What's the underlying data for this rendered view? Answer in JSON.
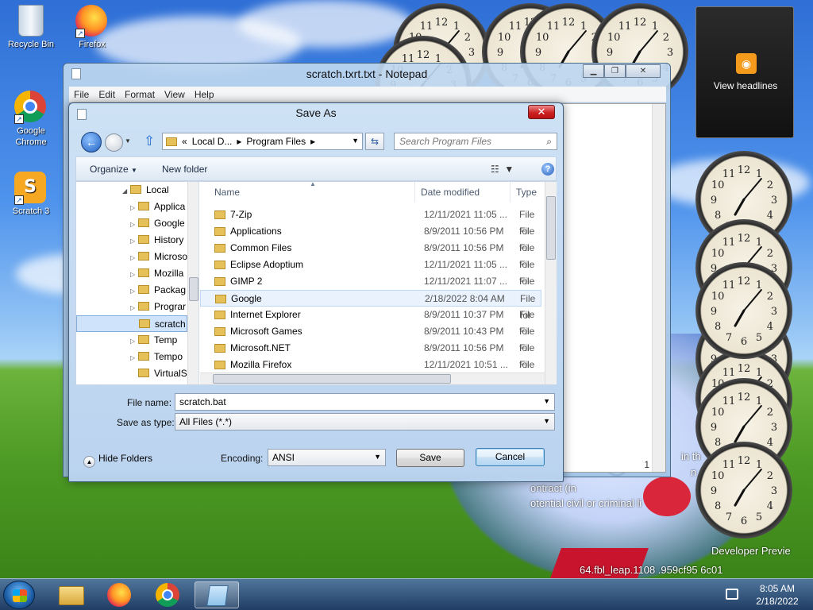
{
  "desktop": {
    "icons": [
      {
        "label": "Recycle Bin",
        "icon": "recycle-bin-icon"
      },
      {
        "label": "Firefox",
        "icon": "firefox-icon"
      },
      {
        "label": "Google Chrome",
        "icon": "chrome-icon"
      },
      {
        "label": "Scratch 3",
        "icon": "scratch-icon"
      }
    ],
    "gadget_label": "View headlines",
    "overlay_lines": [
      "in th",
      "n a",
      "ontract (in",
      "otential civil or criminal li",
      "Developer Previe",
      "64.fbl_leap.1108 .959cf95 6c01"
    ],
    "clock_numbers": [
      "12",
      "1",
      "2",
      "3",
      "4",
      "5",
      "6",
      "7",
      "8",
      "9",
      "10",
      "11"
    ]
  },
  "notepad": {
    "title": "scratch.txrt.txt - Notepad",
    "menu": [
      "File",
      "Edit",
      "Format",
      "View",
      "Help"
    ],
    "status": "1"
  },
  "save_as": {
    "title": "Save As",
    "breadcrumb": [
      "Local D...",
      "Program Files"
    ],
    "breadcrumb_prefix": "«",
    "search_placeholder": "Search Program Files",
    "toolbar": {
      "organize": "Organize",
      "new_folder": "New folder"
    },
    "tree": [
      {
        "label": "Local",
        "expanded": true
      },
      {
        "label": "Applica"
      },
      {
        "label": "Google"
      },
      {
        "label": "History"
      },
      {
        "label": "Microso"
      },
      {
        "label": "Mozilla"
      },
      {
        "label": "Packag"
      },
      {
        "label": "Prograr"
      },
      {
        "label": "scratch",
        "selected": true
      },
      {
        "label": "Temp"
      },
      {
        "label": "Tempo"
      },
      {
        "label": "VirtualS"
      }
    ],
    "columns": [
      "Name",
      "Date modified",
      "Type"
    ],
    "files": [
      {
        "name": "7-Zip",
        "date": "12/11/2021 11:05 ...",
        "type": "File fol"
      },
      {
        "name": "Applications",
        "date": "8/9/2011 10:56 PM",
        "type": "File fol"
      },
      {
        "name": "Common Files",
        "date": "8/9/2011 10:56 PM",
        "type": "File fol"
      },
      {
        "name": "Eclipse Adoptium",
        "date": "12/11/2021 11:05 ...",
        "type": "File fol"
      },
      {
        "name": "GIMP 2",
        "date": "12/11/2021 11:07 ...",
        "type": "File fol"
      },
      {
        "name": "Google",
        "date": "2/18/2022 8:04 AM",
        "type": "File fol"
      },
      {
        "name": "Internet Explorer",
        "date": "8/9/2011 10:37 PM",
        "type": "File fol"
      },
      {
        "name": "Microsoft Games",
        "date": "8/9/2011 10:43 PM",
        "type": "File fol"
      },
      {
        "name": "Microsoft.NET",
        "date": "8/9/2011 10:56 PM",
        "type": "File fol"
      },
      {
        "name": "Mozilla Firefox",
        "date": "12/11/2021 10:51 ...",
        "type": "File fol"
      }
    ],
    "file_name_label": "File name:",
    "file_name_value": "scratch.bat",
    "save_type_label": "Save as type:",
    "save_type_value": "All Files  (*.*)",
    "hide_folders": "Hide Folders",
    "encoding_label": "Encoding:",
    "encoding_value": "ANSI",
    "save_button": "Save",
    "cancel_button": "Cancel"
  },
  "taskbar": {
    "time": "8:05 AM",
    "date": "2/18/2022",
    "pinned": [
      "explorer-icon",
      "firefox-icon",
      "chrome-icon",
      "notepad-icon"
    ]
  }
}
